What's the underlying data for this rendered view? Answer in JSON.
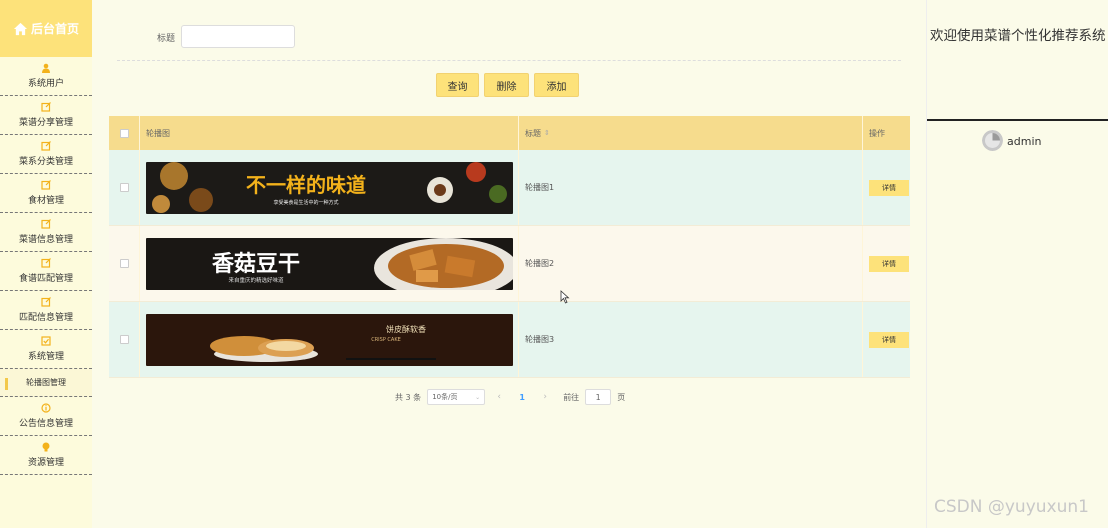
{
  "sidebar": {
    "home_label": "后台首页",
    "items": [
      {
        "label": "系统用户",
        "icon": "user-icon"
      },
      {
        "label": "菜谱分享管理",
        "icon": "edit-icon"
      },
      {
        "label": "菜系分类管理",
        "icon": "edit-icon"
      },
      {
        "label": "食材管理",
        "icon": "edit-icon"
      },
      {
        "label": "菜谱信息管理",
        "icon": "edit-icon"
      },
      {
        "label": "食谱匹配管理",
        "icon": "edit-icon"
      },
      {
        "label": "匹配信息管理",
        "icon": "edit-icon"
      },
      {
        "label": "系统管理",
        "icon": "checkbox-icon"
      },
      {
        "label": "轮播图管理",
        "icon": ""
      },
      {
        "label": "公告信息管理",
        "icon": "info-icon"
      },
      {
        "label": "资源管理",
        "icon": "bulb-icon"
      }
    ]
  },
  "search": {
    "label": "标题",
    "value": ""
  },
  "toolbar": {
    "query_label": "查询",
    "delete_label": "删除",
    "add_label": "添加"
  },
  "table": {
    "headers": {
      "image": "轮播图",
      "title": "标题",
      "action": "操作"
    },
    "rows": [
      {
        "title": "轮播图1",
        "action": "详情",
        "banner_text": "不一样的味道",
        "banner_sub": "享受美食是生活中的一种方式"
      },
      {
        "title": "轮播图2",
        "action": "详情",
        "banner_text": "香菇豆干",
        "banner_sub": "来自重庆的精选好味道"
      },
      {
        "title": "轮播图3",
        "action": "详情",
        "banner_text": "饼皮酥软香",
        "banner_sub": "CRISP CAKE"
      }
    ]
  },
  "pagination": {
    "total": "共 3 条",
    "page_size": "10条/页",
    "current_page": "1",
    "goto_label": "前往",
    "goto_value": "1",
    "page_suffix": "页"
  },
  "right_panel": {
    "welcome": "欢迎使用菜谱个性化推荐系统",
    "username": "admin"
  },
  "watermark": "CSDN @yuyuxun1",
  "colors": {
    "accent": "#fde27a",
    "header_bg": "#f6dc8d",
    "row_even": "#e6f5ee",
    "row_odd": "#fcf8ec",
    "page_bg": "#fbfbe9"
  }
}
